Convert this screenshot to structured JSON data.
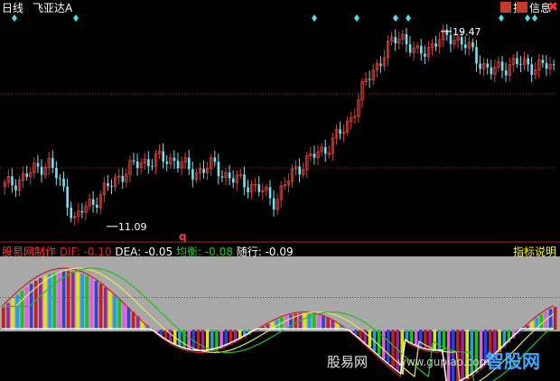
{
  "header": {
    "period": "日线",
    "stock_name": "飞亚达A"
  },
  "toolbar": {
    "indicator_label": "指",
    "info_label": "信息",
    "close_icon": "close-icon"
  },
  "indicator_bar": {
    "name": "股易网制作",
    "dif_label": "DIF:",
    "dif_value": "-0.10",
    "dea_label": "DEA:",
    "dea_value": "-0.05",
    "avg_label": "均衡:",
    "avg_value": "-0.08",
    "follow_label": "随行:",
    "follow_value": "-0.09",
    "help_label": "指标说明"
  },
  "watermark": {
    "site_text": "股易网",
    "brand_text": "智股网",
    "url_text": "www.gupiao.com"
  },
  "colors": {
    "background": "#000000",
    "up_candle": "#d9413a",
    "down_candle": "#6fe4f4",
    "dotted_line": "#b22222",
    "signal": "#4ce0f0",
    "lower_panel_bg": "#a8a8a8",
    "dif_line": "#d22020",
    "dea_line": "#e8e858",
    "follow_line": "#20c020"
  },
  "chart_data": [
    {
      "type": "candlestick",
      "name": "price",
      "y_range": [
        10.5,
        20.2
      ],
      "annotations": [
        {
          "label": "19.47",
          "value": 19.47,
          "kind": "high"
        },
        {
          "label": "11.09",
          "value": 11.09,
          "kind": "low"
        }
      ],
      "signal_marker_count": 9,
      "q_marker": "q"
    },
    {
      "type": "bar",
      "name": "oscillator",
      "y_range": [
        -0.35,
        0.5
      ],
      "series": [
        {
          "name": "DIF"
        },
        {
          "name": "DEA"
        },
        {
          "name": "均衡"
        },
        {
          "name": "随行"
        }
      ]
    }
  ]
}
